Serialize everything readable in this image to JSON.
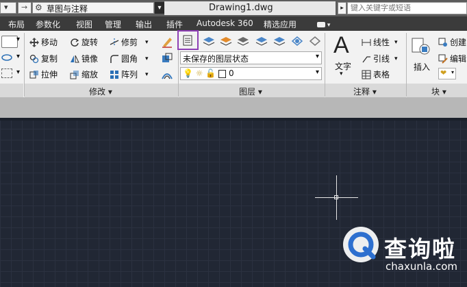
{
  "titlebar": {
    "workspace": "草图与注释",
    "document": "Drawing1.dwg",
    "search_placeholder": "键入关键字或短语"
  },
  "tabs": [
    "布局",
    "参数化",
    "视图",
    "管理",
    "输出",
    "插件",
    "Autodesk 360",
    "精选应用"
  ],
  "ribbon": {
    "modify": {
      "move": "移动",
      "rotate": "旋转",
      "trim": "修剪",
      "copy": "复制",
      "mirror": "镜像",
      "fillet": "圆角",
      "stretch": "拉伸",
      "scale": "缩放",
      "array": "阵列",
      "title": "修改"
    },
    "layers": {
      "state": "未保存的图层状态",
      "current_layer": "0",
      "title": "图层"
    },
    "annotation": {
      "text": "文字",
      "linear": "线性",
      "leader": "引线",
      "table": "表格",
      "title": "注释"
    },
    "block": {
      "insert": "插入",
      "create": "创建",
      "edit": "编辑",
      "title": "块"
    }
  },
  "watermark": {
    "text": "查询啦",
    "url": "chaxunla.com"
  },
  "colors": {
    "highlight": "#8e3fb5",
    "canvas": "#212734"
  }
}
